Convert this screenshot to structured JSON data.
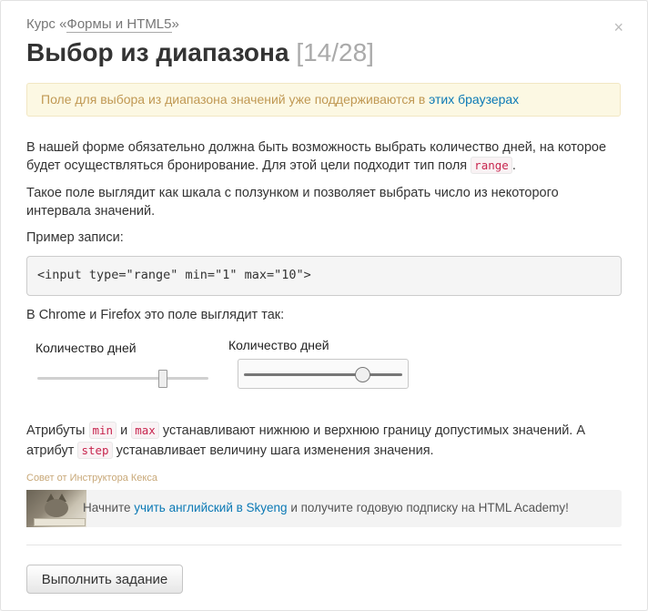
{
  "header": {
    "course_prefix": "Курс «",
    "course_name": "Формы и HTML5",
    "course_suffix": "»",
    "close_glyph": "×",
    "title": "Выбор из диапазона",
    "counter": "[14/28]"
  },
  "notice": {
    "text": "Поле для выбора из диапазона значений уже поддерживаются в ",
    "link": "этих браузерах"
  },
  "content": {
    "p1_a": "В нашей форме обязательно должна быть возможность выбрать количество дней, на которое будет осуществляться бронирование. Для этой цели подходит тип поля ",
    "p1_code": "range",
    "p1_b": ".",
    "p2": "Такое поле выглядит как шкала с ползунком и позволяет выбрать число из некоторого интервала значений.",
    "p3": "Пример записи:",
    "code_example": "<input type=\"range\" min=\"1\" max=\"10\">",
    "p4": "В Chrome и Firefox это поле выглядит так:",
    "demo_label_chrome": "Количество дней",
    "demo_label_firefox": "Количество дней",
    "p5_a": "Атрибуты ",
    "p5_code1": "min",
    "p5_b": " и ",
    "p5_code2": "max",
    "p5_c": " устанавливают нижнюю и верхнюю границу допустимых значений. А атрибут ",
    "p5_code3": "step",
    "p5_d": " устанавливает величину шага изменения значения."
  },
  "tip": {
    "caption": "Совет от Инструктора Кекса",
    "text_a": "Начните ",
    "link": "учить английский в Skyeng",
    "text_b": " и получите годовую подписку на HTML Academy!"
  },
  "actions": {
    "submit_label": "Выполнить задание"
  }
}
